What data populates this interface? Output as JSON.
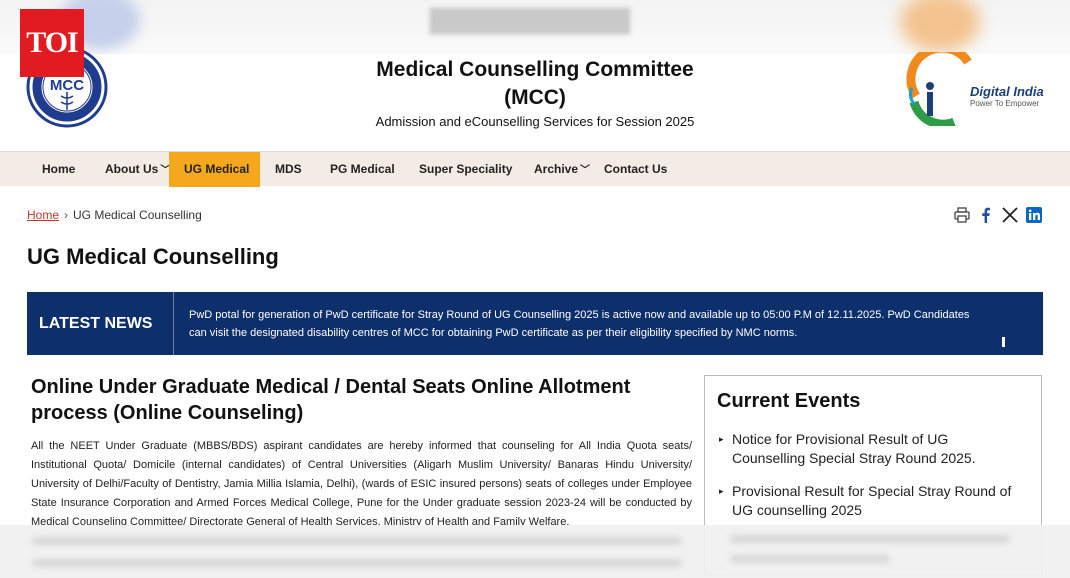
{
  "branding": {
    "toi_label": "TOI",
    "title": "Medical Counselling Committee (MCC)",
    "subtitle": "Admission and eCounselling Services for Session 2025",
    "mcc_logo_text": "MCC",
    "digital_india_title": "Digital India",
    "digital_india_tagline": "Power To Empower"
  },
  "nav": {
    "items": [
      {
        "label": "Home"
      },
      {
        "label": "About Us"
      },
      {
        "label": "UG Medical"
      },
      {
        "label": "MDS"
      },
      {
        "label": "PG Medical"
      },
      {
        "label": "Super Speciality"
      },
      {
        "label": "Archive"
      },
      {
        "label": "Contact Us"
      }
    ],
    "chevron": "⌄"
  },
  "breadcrumb": {
    "home": "Home",
    "separator": "›",
    "current": "UG Medical Counselling"
  },
  "share": {
    "icons": [
      "print-icon",
      "facebook-icon",
      "x-icon",
      "linkedin-icon"
    ]
  },
  "page": {
    "title": "UG Medical Counselling"
  },
  "latest_news": {
    "label": "LATEST NEWS",
    "text": "PwD potal for generation of PwD certificate for Stray Round of UG Counselling 2025 is active now and available up to 05:00 P.M of 12.11.2025. PwD Candidates can visit the designated disability centres of MCC for obtaining PwD certificate as per their eligibility specified by NMC norms."
  },
  "article": {
    "title": "Online Under Graduate Medical / Dental Seats Online Allotment process (Online Counseling)",
    "body": "All the NEET Under Graduate (MBBS/BDS) aspirant candidates are hereby informed that counseling for All India Quota seats/ Institutional Quota/ Domicile (internal candidates) of Central Universities (Aligarh Muslim University/ Banaras Hindu University/ University of Delhi/Faculty of Dentistry, Jamia Millia Islamia, Delhi), (wards of ESIC insured persons) seats of colleges under Employee State Insurance Corporation and Armed Forces Medical College, Pune for the Under graduate session 2023-24 will be conducted by Medical Counseling Committee/ Directorate General of Health Services, Ministry of Health and Family Welfare."
  },
  "current_events": {
    "title": "Current Events",
    "items": [
      {
        "text": "Notice for Provisional Result of UG Counselling Special Stray Round 2025."
      },
      {
        "text": "Provisional Result for Special Stray Round of UG counselling 2025"
      }
    ],
    "bullet": "▸"
  },
  "colors": {
    "toi_red": "#e21b22",
    "nav_bg": "#f2ece4",
    "nav_active": "#f4a81d",
    "news_bg": "#0d2f6b",
    "link_red": "#c0392b"
  }
}
